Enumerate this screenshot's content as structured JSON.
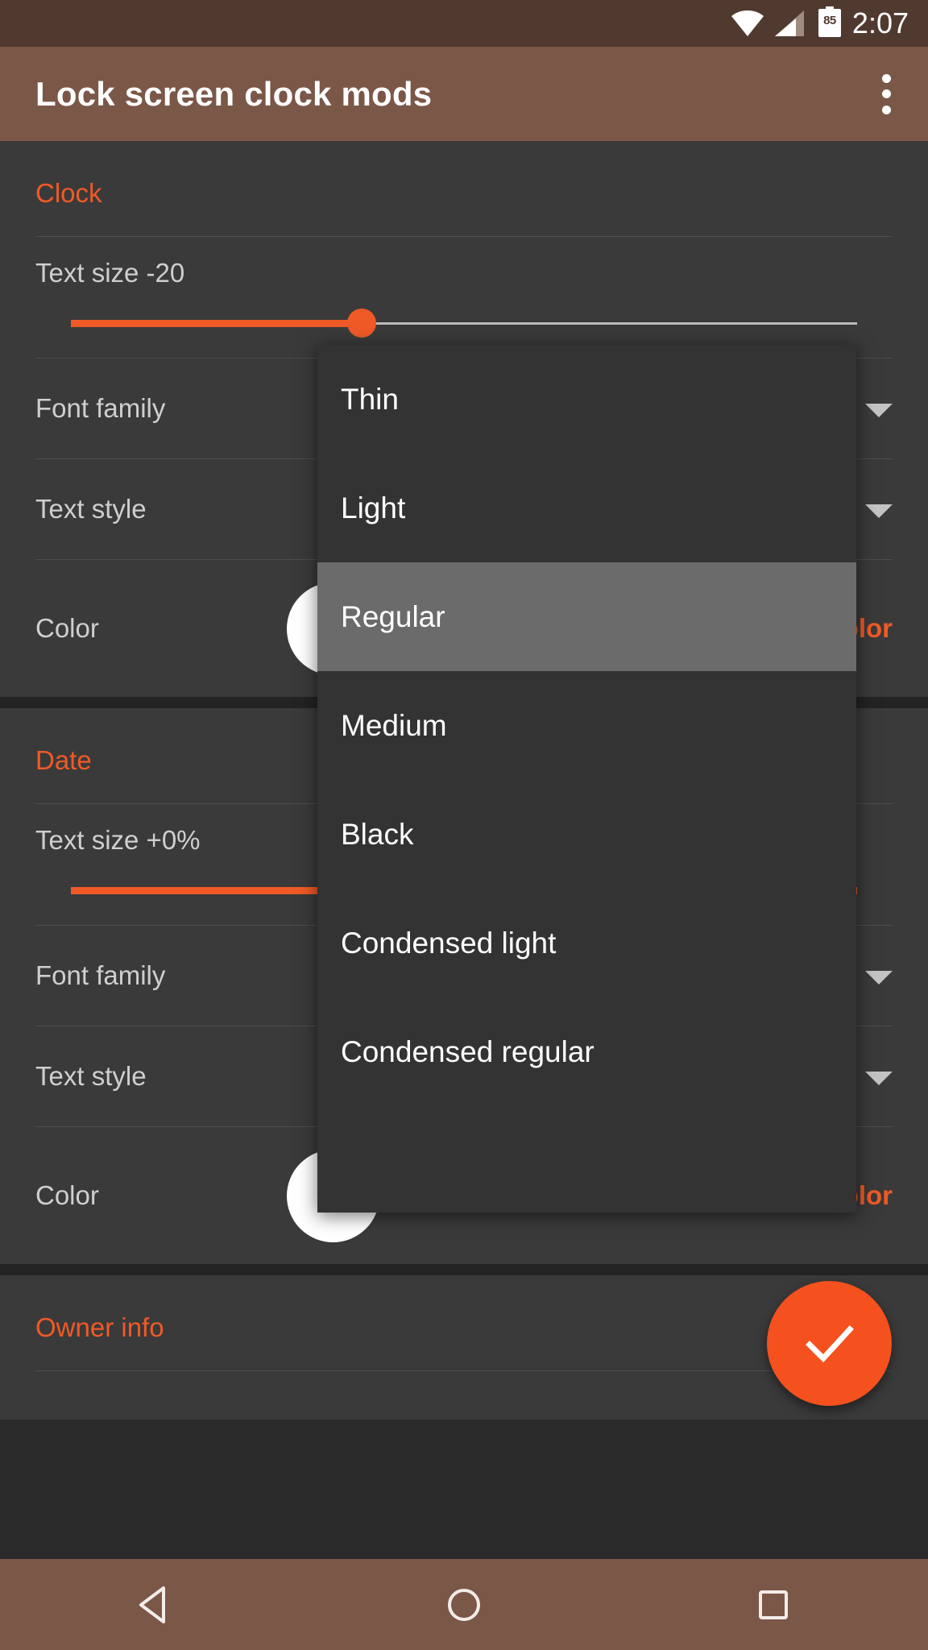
{
  "status_bar": {
    "wifi_icon": "wifi-icon",
    "signal_icon": "cellular-signal-icon",
    "battery_icon": "battery-icon",
    "battery_level": "85",
    "time": "2:07"
  },
  "app_bar": {
    "title": "Lock screen clock mods",
    "overflow_icon": "overflow-menu-icon"
  },
  "sections": {
    "clock": {
      "header": "Clock",
      "text_size_label": "Text size -20",
      "slider_percent": 37,
      "font_family_label": "Font family",
      "text_style_label": "Text style",
      "color_label": "Color",
      "color_swatch": "#ffffff",
      "restore_label": "Restore stock color"
    },
    "date": {
      "header": "Date",
      "text_size_label": "Text size +0%",
      "slider_percent": 100,
      "font_family_label": "Font family",
      "text_style_label": "Text style",
      "color_label": "Color",
      "color_swatch": "#ffffff",
      "restore_label": "Restore stock color"
    },
    "owner": {
      "header": "Owner info"
    }
  },
  "dropdown": {
    "items": [
      {
        "label": "Thin",
        "selected": false
      },
      {
        "label": "Light",
        "selected": false
      },
      {
        "label": "Regular",
        "selected": true
      },
      {
        "label": "Medium",
        "selected": false
      },
      {
        "label": "Black",
        "selected": false
      },
      {
        "label": "Condensed light",
        "selected": false
      },
      {
        "label": "Condensed regular",
        "selected": false
      }
    ]
  },
  "fab": {
    "icon": "check-icon"
  },
  "nav_bar": {
    "back_icon": "back-triangle-icon",
    "home_icon": "home-circle-icon",
    "recents_icon": "recents-square-icon"
  },
  "colors": {
    "accent": "#ef5a27",
    "app_bar": "#7b5748",
    "status_bar": "#503a30",
    "card": "#3a3a3a",
    "background": "#2a2a2a",
    "dropdown": "#333333",
    "dropdown_selected": "#6b6b6b"
  }
}
